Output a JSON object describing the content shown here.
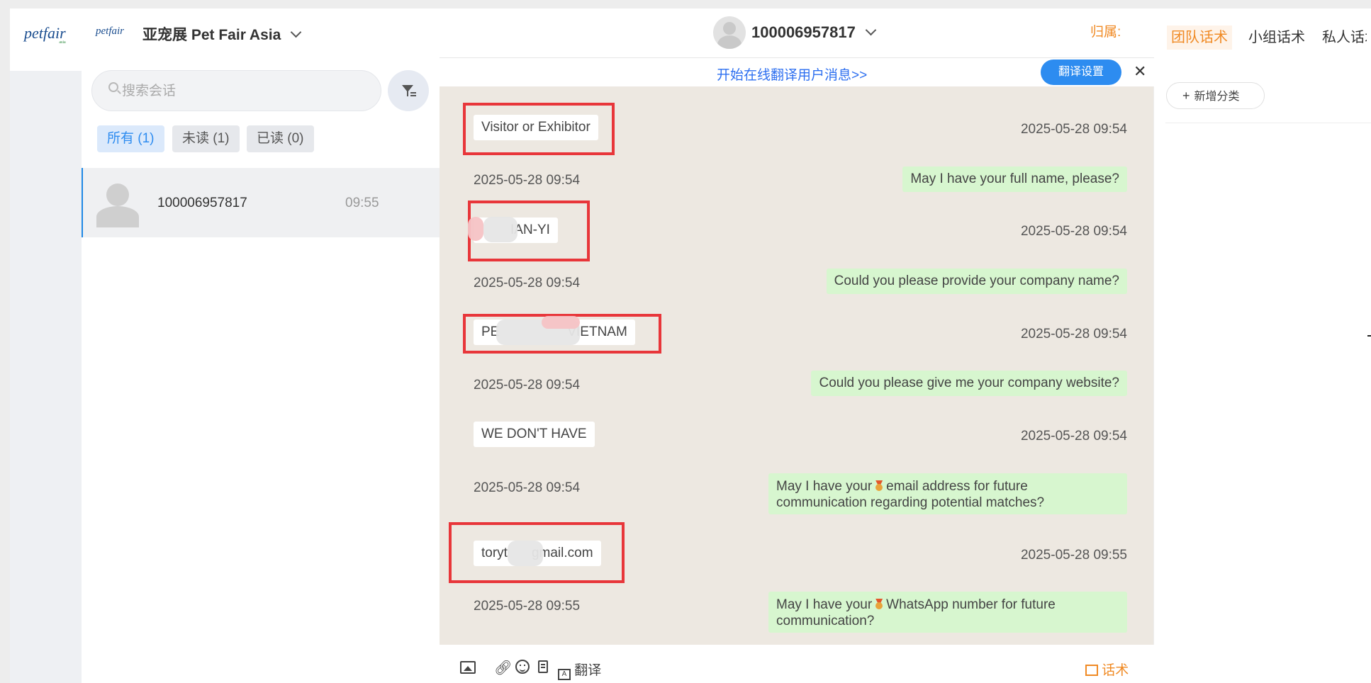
{
  "app": {
    "logo_text": "petfair",
    "logo_sub": "asia",
    "org_name": "亚宠展 Pet Fair Asia"
  },
  "header": {
    "contact_id": "100006957817",
    "belong_label": "归属:"
  },
  "search": {
    "placeholder": "搜索会话"
  },
  "filters": [
    {
      "label": "所有 (1)",
      "active": true
    },
    {
      "label": "未读 (1)",
      "active": false
    },
    {
      "label": "已读 (0)",
      "active": false
    }
  ],
  "conversations": [
    {
      "name": "100006957817",
      "time": "09:55"
    }
  ],
  "translate_bar": {
    "prompt": "开始在线翻译用户消息>>",
    "settings_button": "翻译设置"
  },
  "messages": [
    {
      "side": "left",
      "text": "Visitor or Exhibitor",
      "time": "2025-05-28 09:54",
      "highlighted": true
    },
    {
      "side": "right",
      "text": "May I have your full name, please?",
      "time": "2025-05-28 09:54"
    },
    {
      "side": "left",
      "text": "IAN-YI",
      "time": "2025-05-28 09:54",
      "highlighted": true,
      "redacted": true
    },
    {
      "side": "right",
      "text": "Could you please provide your company name?",
      "time": "2025-05-28 09:54"
    },
    {
      "side": "left",
      "text_a": "PE",
      "text_b": "VIETNAM",
      "time": "2025-05-28 09:54",
      "highlighted": true,
      "redacted": true
    },
    {
      "side": "right",
      "text": "Could you please give me your company website?",
      "time": "2025-05-28 09:54"
    },
    {
      "side": "left",
      "text": "WE DON'T HAVE",
      "time": "2025-05-28 09:54"
    },
    {
      "side": "right",
      "line1_a": "May I have your",
      "line1_b": "email address for future",
      "line2": "communication regarding potential matches?",
      "time": "2025-05-28 09:54"
    },
    {
      "side": "left",
      "text_a": "toryt",
      "text_b": "gmail.com",
      "time": "2025-05-28 09:55",
      "highlighted": true,
      "redacted": true
    },
    {
      "side": "right",
      "line1_a": "May I have your",
      "line1_b": "WhatsApp number for future",
      "line2": "communication?",
      "time": "2025-05-28 09:55"
    }
  ],
  "input_bar": {
    "translate_label": "翻译",
    "scripts_label": "话术"
  },
  "right_panel": {
    "tabs": [
      "团队话术",
      "小组话术",
      "私人话术"
    ],
    "active_tab": 0,
    "add_category": "新增分类"
  },
  "colors": {
    "accent_orange": "#f08a24",
    "primary_blue": "#2d8cf0",
    "highlight_red": "#e8363a",
    "bubble_green": "#d7f6cf",
    "chat_bg": "#ede8e1"
  }
}
